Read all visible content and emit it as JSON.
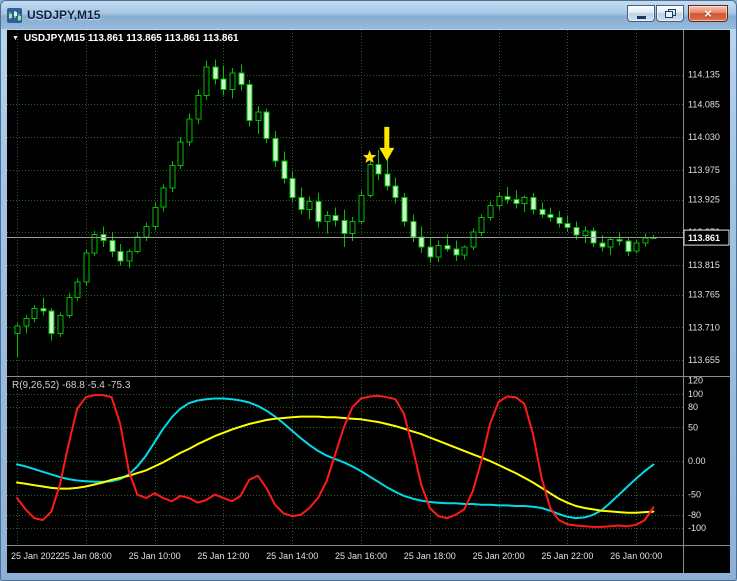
{
  "window": {
    "title": "USDJPY,M15",
    "close_glyph": "×"
  },
  "info_bar": {
    "collapse_glyph": "▼",
    "text": "USDJPY,M15 113.861 113.865 113.861 113.861"
  },
  "price_axis": {
    "ticks": [
      "114.135",
      "114.085",
      "114.030",
      "113.975",
      "113.925",
      "113.870",
      "113.815",
      "113.765",
      "113.710",
      "113.655"
    ],
    "current": "113.861"
  },
  "time_axis": {
    "labels": [
      "25 Jan 2022",
      "25 Jan 08:00",
      "25 Jan 10:00",
      "25 Jan 12:00",
      "25 Jan 14:00",
      "25 Jan 16:00",
      "25 Jan 18:00",
      "25 Jan 20:00",
      "25 Jan 22:00",
      "26 Jan 00:00"
    ]
  },
  "indicator_panel": {
    "label": "R(9,26,52) -68.8 -5.4 -75.3",
    "levels": [
      120,
      100,
      80,
      50,
      0,
      -50,
      -80,
      -100
    ],
    "level_labels": [
      "120",
      "100",
      "80",
      "50",
      "0.00",
      "-50",
      "-80",
      "-100"
    ]
  },
  "colors": {
    "background": "#000000",
    "grid": "#2a5f2a",
    "candle_outline": "#00c000",
    "bull_fill": "#000000",
    "bear_fill": "#ccf5cc",
    "price_line": "#9a9a9a",
    "axis_text": "#e0e0e0",
    "red_line": "#ff1a1a",
    "yellow_line": "#ffff00",
    "cyan_line": "#00dbe8",
    "annotation": "#ffe400"
  },
  "chart_data": {
    "type": "candlestick",
    "symbol": "USDJPY",
    "timeframe": "M15",
    "grid_step": 8,
    "price_range": [
      113.63,
      114.21
    ],
    "current_price": 113.861,
    "candles": [
      [
        113.7,
        113.718,
        113.66,
        113.712
      ],
      [
        113.712,
        113.73,
        113.7,
        113.725
      ],
      [
        113.725,
        113.748,
        113.718,
        113.742
      ],
      [
        113.742,
        113.76,
        113.73,
        113.738
      ],
      [
        113.738,
        113.742,
        113.688,
        113.7
      ],
      [
        113.7,
        113.735,
        113.694,
        113.73
      ],
      [
        113.73,
        113.768,
        113.726,
        113.76
      ],
      [
        113.76,
        113.792,
        113.755,
        113.786
      ],
      [
        113.786,
        113.84,
        113.78,
        113.835
      ],
      [
        113.835,
        113.872,
        113.83,
        113.866
      ],
      [
        113.866,
        113.88,
        113.845,
        113.856
      ],
      [
        113.856,
        113.87,
        113.828,
        113.838
      ],
      [
        113.838,
        113.85,
        113.814,
        113.822
      ],
      [
        113.822,
        113.842,
        113.81,
        113.838
      ],
      [
        113.838,
        113.87,
        113.834,
        113.862
      ],
      [
        113.862,
        113.886,
        113.855,
        113.88
      ],
      [
        113.88,
        113.92,
        113.874,
        113.912
      ],
      [
        113.912,
        113.95,
        113.905,
        113.944
      ],
      [
        113.944,
        113.99,
        113.938,
        113.982
      ],
      [
        113.982,
        114.03,
        113.976,
        114.022
      ],
      [
        114.022,
        114.07,
        114.015,
        114.06
      ],
      [
        114.06,
        114.11,
        114.052,
        114.1
      ],
      [
        114.1,
        114.158,
        114.092,
        114.148
      ],
      [
        114.148,
        114.16,
        114.118,
        114.128
      ],
      [
        114.128,
        114.15,
        114.1,
        114.11
      ],
      [
        114.11,
        114.146,
        114.095,
        114.138
      ],
      [
        114.138,
        114.152,
        114.108,
        114.118
      ],
      [
        114.118,
        114.126,
        114.048,
        114.058
      ],
      [
        114.058,
        114.082,
        114.035,
        114.072
      ],
      [
        114.072,
        114.078,
        114.02,
        114.028
      ],
      [
        114.028,
        114.04,
        113.98,
        113.99
      ],
      [
        113.99,
        114.006,
        113.952,
        113.96
      ],
      [
        113.96,
        113.972,
        113.92,
        113.928
      ],
      [
        113.928,
        113.945,
        113.9,
        113.908
      ],
      [
        113.908,
        113.93,
        113.892,
        113.922
      ],
      [
        113.922,
        113.936,
        113.878,
        113.888
      ],
      [
        113.888,
        113.906,
        113.868,
        113.898
      ],
      [
        113.898,
        113.912,
        113.88,
        113.89
      ],
      [
        113.89,
        113.908,
        113.845,
        113.868
      ],
      [
        113.868,
        113.896,
        113.855,
        113.888
      ],
      [
        113.888,
        113.94,
        113.884,
        113.932
      ],
      [
        113.932,
        113.99,
        113.928,
        113.984
      ],
      [
        113.984,
        114.008,
        113.958,
        113.968
      ],
      [
        113.968,
        113.996,
        113.94,
        113.948
      ],
      [
        113.948,
        113.962,
        113.918,
        113.928
      ],
      [
        113.928,
        113.936,
        113.88,
        113.888
      ],
      [
        113.888,
        113.9,
        113.854,
        113.862
      ],
      [
        113.862,
        113.88,
        113.835,
        113.845
      ],
      [
        113.845,
        113.862,
        113.818,
        113.828
      ],
      [
        113.828,
        113.856,
        113.82,
        113.848
      ],
      [
        113.848,
        113.866,
        113.838,
        113.842
      ],
      [
        113.842,
        113.856,
        113.822,
        113.832
      ],
      [
        113.832,
        113.848,
        113.824,
        113.845
      ],
      [
        113.845,
        113.876,
        113.84,
        113.87
      ],
      [
        113.87,
        113.9,
        113.864,
        113.895
      ],
      [
        113.895,
        113.922,
        113.89,
        113.915
      ],
      [
        113.915,
        113.938,
        113.908,
        113.93
      ],
      [
        113.93,
        113.946,
        113.918,
        113.925
      ],
      [
        113.925,
        113.94,
        113.91,
        113.918
      ],
      [
        113.918,
        113.932,
        113.904,
        113.928
      ],
      [
        113.928,
        113.936,
        113.9,
        113.908
      ],
      [
        113.908,
        113.92,
        113.895,
        113.9
      ],
      [
        113.9,
        113.912,
        113.888,
        113.895
      ],
      [
        113.895,
        113.906,
        113.878,
        113.885
      ],
      [
        113.885,
        113.898,
        113.87,
        113.878
      ],
      [
        113.878,
        113.888,
        113.858,
        113.865
      ],
      [
        113.865,
        113.88,
        113.852,
        113.872
      ],
      [
        113.872,
        113.878,
        113.845,
        113.852
      ],
      [
        113.852,
        113.865,
        113.838,
        113.845
      ],
      [
        113.845,
        113.862,
        113.832,
        113.858
      ],
      [
        113.858,
        113.87,
        113.848,
        113.855
      ],
      [
        113.855,
        113.86,
        113.83,
        113.838
      ],
      [
        113.838,
        113.858,
        113.834,
        113.852
      ],
      [
        113.852,
        113.868,
        113.846,
        113.86
      ],
      [
        113.861,
        113.865,
        113.861,
        113.861
      ]
    ],
    "oscillator": {
      "name": "R(9,26,52)",
      "range": [
        -125,
        125
      ],
      "series": [
        {
          "name": "slow",
          "color_key": "cyan_line",
          "values": [
            -5,
            -8,
            -12,
            -16,
            -20,
            -24,
            -27,
            -29,
            -30,
            -31,
            -31,
            -30,
            -27,
            -20,
            -8,
            8,
            28,
            48,
            65,
            78,
            86,
            90,
            92,
            93,
            93,
            92,
            90,
            87,
            82,
            75,
            66,
            56,
            45,
            34,
            24,
            15,
            8,
            3,
            -2,
            -8,
            -15,
            -23,
            -31,
            -39,
            -46,
            -52,
            -56,
            -59,
            -61,
            -62,
            -63,
            -63,
            -64,
            -64,
            -65,
            -65,
            -66,
            -66,
            -67,
            -67,
            -68,
            -70,
            -74,
            -79,
            -83,
            -85,
            -84,
            -80,
            -73,
            -62,
            -50,
            -38,
            -26,
            -15,
            -5.4
          ]
        },
        {
          "name": "mid",
          "color_key": "yellow_line",
          "values": [
            -32,
            -34,
            -36,
            -38,
            -40,
            -41,
            -41,
            -40,
            -38,
            -35,
            -32,
            -28,
            -25,
            -22,
            -18,
            -14,
            -8,
            -2,
            5,
            12,
            18,
            25,
            31,
            37,
            42,
            47,
            51,
            55,
            58,
            61,
            63,
            64,
            65,
            66,
            66,
            66,
            65,
            65,
            64,
            63,
            62,
            60,
            58,
            55,
            52,
            48,
            44,
            40,
            35,
            30,
            25,
            20,
            15,
            10,
            5,
            0,
            -6,
            -12,
            -18,
            -25,
            -32,
            -40,
            -48,
            -56,
            -62,
            -67,
            -70,
            -72,
            -74,
            -75,
            -76,
            -77,
            -77,
            -76,
            -75.3
          ]
        },
        {
          "name": "fast",
          "color_key": "red_line",
          "values": [
            -55,
            -72,
            -85,
            -88,
            -75,
            -35,
            25,
            78,
            95,
            98,
            98,
            95,
            55,
            -15,
            -50,
            -55,
            -48,
            -55,
            -60,
            -52,
            -55,
            -62,
            -58,
            -50,
            -55,
            -60,
            -52,
            -28,
            -22,
            -40,
            -65,
            -78,
            -82,
            -80,
            -70,
            -55,
            -30,
            10,
            50,
            80,
            93,
            96,
            97,
            95,
            92,
            70,
            20,
            -35,
            -70,
            -82,
            -85,
            -80,
            -72,
            -45,
            0,
            55,
            88,
            96,
            95,
            85,
            40,
            -25,
            -70,
            -88,
            -94,
            -96,
            -97,
            -98,
            -98,
            -97,
            -96,
            -97,
            -95,
            -88,
            -68.8
          ]
        }
      ]
    },
    "annotations": [
      {
        "type": "star",
        "candle_index": 41,
        "price": 113.996,
        "color": "#ffe400"
      },
      {
        "type": "arrow-down",
        "candle_index": 43,
        "tip_price": 113.99,
        "color": "#ffe400"
      }
    ]
  }
}
